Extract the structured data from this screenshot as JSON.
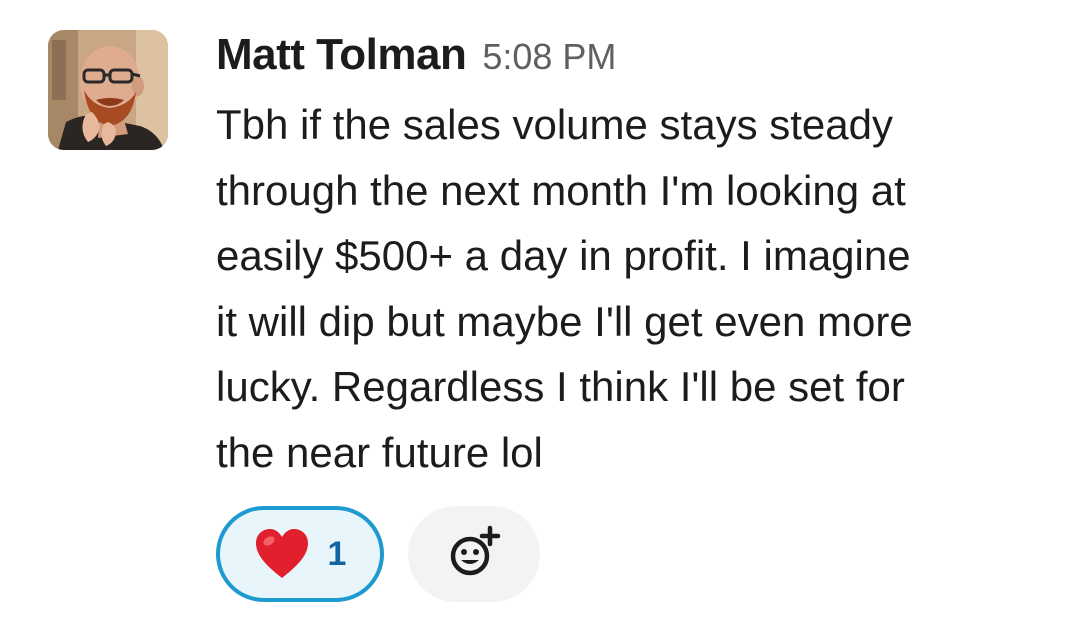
{
  "message": {
    "sender": "Matt Tolman",
    "timestamp": "5:08 PM",
    "text_lines": [
      "Tbh if the sales volume stays steady",
      "through the next month I'm looking at",
      "easily $500+ a day in profit. I imagine",
      "it will dip but maybe I'll get even more",
      "lucky. Regardless I think I'll be set for",
      "the near future lol"
    ],
    "avatar_icon": "user-avatar-photo"
  },
  "reactions": [
    {
      "emoji": "heart",
      "count": "1",
      "selected": true
    }
  ],
  "add_reaction_icon": "add-emoji-icon",
  "colors": {
    "text": "#1d1c1d",
    "timestamp": "#616061",
    "reaction_border": "#1d9bd1",
    "reaction_bg": "#e8f5fa",
    "reaction_count": "#1264a3",
    "heart": "#e0202c",
    "add_reaction_bg": "#f3f3f3"
  }
}
